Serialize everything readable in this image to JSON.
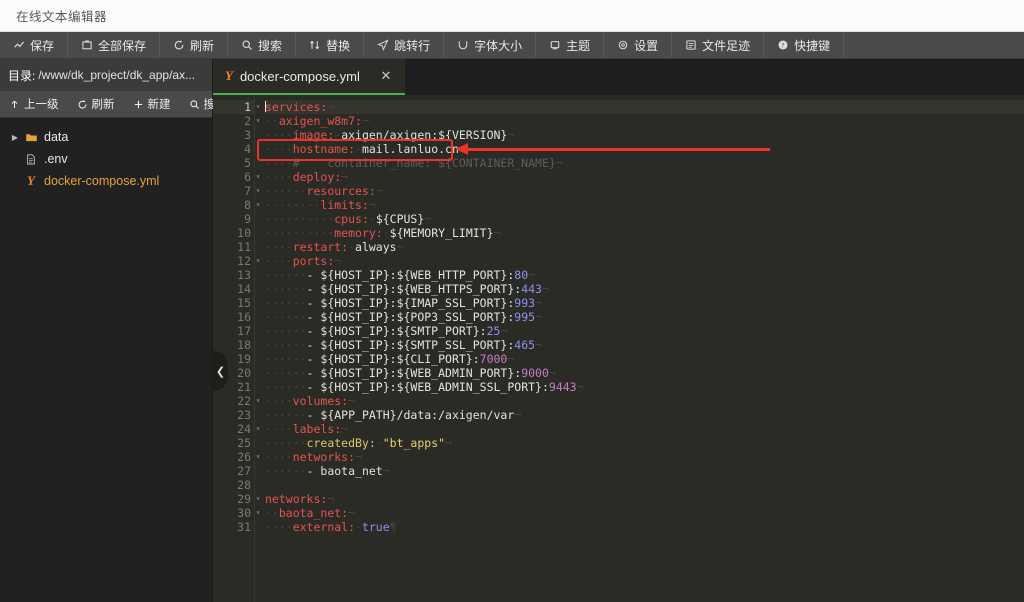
{
  "window": {
    "title": "在线文本编辑器"
  },
  "toolbar": {
    "items": [
      {
        "label": "保存",
        "icon": "save-icon"
      },
      {
        "label": "全部保存",
        "icon": "save-all-icon"
      },
      {
        "label": "刷新",
        "icon": "refresh-icon"
      },
      {
        "label": "搜索",
        "icon": "search-icon"
      },
      {
        "label": "替换",
        "icon": "replace-icon"
      },
      {
        "label": "跳转行",
        "icon": "goto-line-icon"
      },
      {
        "label": "字体大小",
        "icon": "font-size-icon"
      },
      {
        "label": "主题",
        "icon": "theme-icon"
      },
      {
        "label": "设置",
        "icon": "gear-icon"
      },
      {
        "label": "文件足迹",
        "icon": "history-icon"
      },
      {
        "label": "快捷键",
        "icon": "help-icon"
      }
    ]
  },
  "sidebar": {
    "dir_label": "目录:",
    "dir_path": "/www/dk_project/dk_app/ax...",
    "actions": [
      {
        "label": "上一级",
        "icon": "arrow-up-icon"
      },
      {
        "label": "刷新",
        "icon": "refresh-icon"
      },
      {
        "label": "新建",
        "icon": "plus-icon"
      },
      {
        "label": "搜索",
        "icon": "search-icon"
      }
    ],
    "tree": [
      {
        "name": "data",
        "type": "folder",
        "selected": false,
        "icon": "folder-icon",
        "caret": "▶"
      },
      {
        "name": ".env",
        "type": "file",
        "selected": false,
        "icon": "document-icon",
        "caret": ""
      },
      {
        "name": "docker-compose.yml",
        "type": "file",
        "selected": true,
        "icon": "yaml-icon",
        "caret": ""
      }
    ]
  },
  "editor": {
    "tab": {
      "label": "docker-compose.yml",
      "icon": "yaml-icon",
      "close": "✕"
    },
    "active_line": 1,
    "fold_lines": [
      1,
      2,
      6,
      7,
      8,
      12,
      22,
      24,
      26,
      29,
      30
    ],
    "collapse_handle_icon": "chevron-left-icon",
    "lines": [
      {
        "n": 1,
        "text": "services:"
      },
      {
        "n": 2,
        "text": "  axigen_w8m7:"
      },
      {
        "n": 3,
        "text": "    image: axigen/axigen:${VERSION}"
      },
      {
        "n": 4,
        "text": "    hostname: mail.lanluo.cn"
      },
      {
        "n": 5,
        "text": "    #    container_name: ${CONTAINER_NAME}"
      },
      {
        "n": 6,
        "text": "    deploy:"
      },
      {
        "n": 7,
        "text": "      resources:"
      },
      {
        "n": 8,
        "text": "        limits:"
      },
      {
        "n": 9,
        "text": "          cpus: ${CPUS}"
      },
      {
        "n": 10,
        "text": "          memory: ${MEMORY_LIMIT}"
      },
      {
        "n": 11,
        "text": "    restart: always"
      },
      {
        "n": 12,
        "text": "    ports:"
      },
      {
        "n": 13,
        "text": "      - ${HOST_IP}:${WEB_HTTP_PORT}:80"
      },
      {
        "n": 14,
        "text": "      - ${HOST_IP}:${WEB_HTTPS_PORT}:443"
      },
      {
        "n": 15,
        "text": "      - ${HOST_IP}:${IMAP_SSL_PORT}:993"
      },
      {
        "n": 16,
        "text": "      - ${HOST_IP}:${POP3_SSL_PORT}:995"
      },
      {
        "n": 17,
        "text": "      - ${HOST_IP}:${SMTP_PORT}:25"
      },
      {
        "n": 18,
        "text": "      - ${HOST_IP}:${SMTP_SSL_PORT}:465"
      },
      {
        "n": 19,
        "text": "      - ${HOST_IP}:${CLI_PORT}:7000"
      },
      {
        "n": 20,
        "text": "      - ${HOST_IP}:${WEB_ADMIN_PORT}:9000"
      },
      {
        "n": 21,
        "text": "      - ${HOST_IP}:${WEB_ADMIN_SSL_PORT}:9443"
      },
      {
        "n": 22,
        "text": "    volumes:"
      },
      {
        "n": 23,
        "text": "      - ${APP_PATH}/data:/axigen/var"
      },
      {
        "n": 24,
        "text": "    labels:"
      },
      {
        "n": 25,
        "text": "      createdBy: \"bt_apps\""
      },
      {
        "n": 26,
        "text": "    networks:"
      },
      {
        "n": 27,
        "text": "      - baota_net"
      },
      {
        "n": 28,
        "text": ""
      },
      {
        "n": 29,
        "text": "networks:"
      },
      {
        "n": 30,
        "text": "  baota_net:"
      },
      {
        "n": 31,
        "text": "    external: true"
      }
    ]
  },
  "annotation": {
    "highlight_text": "hostname: mail.lanluo.cn",
    "highlight_color": "#e8342a",
    "arrow_color": "#e8342a"
  }
}
